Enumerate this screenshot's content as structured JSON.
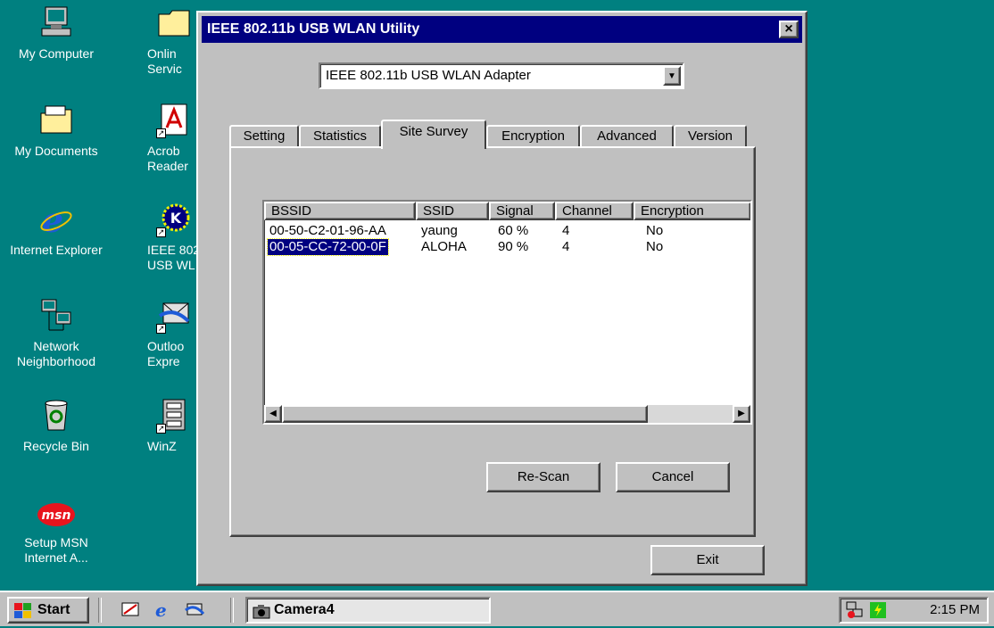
{
  "desktop": {
    "icons_col1": [
      {
        "name": "My Computer"
      },
      {
        "name": "My Documents"
      },
      {
        "name": "Internet Explorer"
      },
      {
        "name": "Network Neighborhood"
      },
      {
        "name": "Recycle Bin"
      },
      {
        "name": "Setup MSN Internet A..."
      }
    ],
    "icons_col2": [
      {
        "name": "Onlin Servic"
      },
      {
        "name": "Acrob Reader"
      },
      {
        "name": "IEEE 802 USB WL"
      },
      {
        "name": "Outloo Expre"
      },
      {
        "name": "WinZ"
      }
    ],
    "msn_logo": "msn"
  },
  "window": {
    "title": "IEEE 802.11b USB WLAN Utility",
    "close_glyph": "×",
    "adapter": "IEEE 802.11b USB WLAN Adapter",
    "tabs": [
      "Setting",
      "Statistics",
      "Site Survey",
      "Encryption",
      "Advanced",
      "Version"
    ],
    "active_tab": "Site Survey",
    "columns": [
      "BSSID",
      "SSID",
      "Signal",
      "Channel",
      "Encryption"
    ],
    "rows": [
      {
        "bssid": "00-50-C2-01-96-AA",
        "ssid": "yaung",
        "signal": "60 %",
        "channel": "4",
        "encryption": "No",
        "selected": false
      },
      {
        "bssid": "00-05-CC-72-00-0F",
        "ssid": "ALOHA",
        "signal": "90 %",
        "channel": "4",
        "encryption": "No",
        "selected": true
      }
    ],
    "rescan_label": "Re-Scan",
    "cancel_label": "Cancel",
    "exit_label": "Exit"
  },
  "taskbar": {
    "start_label": "Start",
    "task_label": "Camera4",
    "clock": "2:15 PM"
  },
  "colors": {
    "desktop": "#008080",
    "titlebar": "#000080",
    "face": "#c0c0c0",
    "selection": "#000080"
  }
}
